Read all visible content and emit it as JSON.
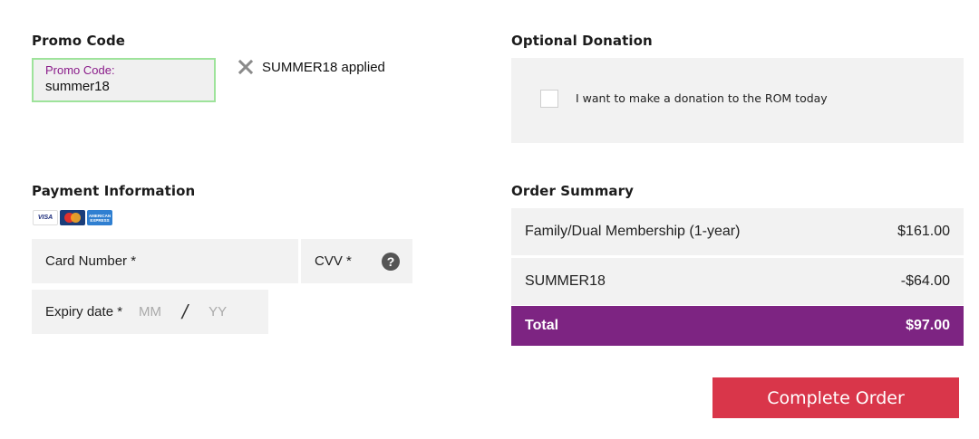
{
  "promo": {
    "title": "Promo Code",
    "field_label": "Promo Code:",
    "field_value": "summer18",
    "applied_text": "SUMMER18 applied"
  },
  "donation": {
    "title": "Optional Donation",
    "checkbox_label": "I want to make a donation to the ROM today",
    "checked": false
  },
  "payment": {
    "title": "Payment Information",
    "card_logos": [
      "VISA",
      "MasterCard",
      "AMERICAN EXPRESS"
    ],
    "card_number_label": "Card Number *",
    "cvv_label": "CVV *",
    "help_glyph": "?",
    "expiry_label": "Expiry date *",
    "expiry_month_placeholder": "MM",
    "expiry_separator": "/",
    "expiry_year_placeholder": "YY"
  },
  "summary": {
    "title": "Order Summary",
    "items": [
      {
        "label": "Family/Dual Membership (1-year)",
        "amount": "$161.00"
      },
      {
        "label": "SUMMER18",
        "amount": "-$64.00"
      }
    ],
    "total_label": "Total",
    "total_amount": "$97.00"
  },
  "actions": {
    "complete_label": "Complete Order"
  },
  "colors": {
    "accent_purple": "#7d2482",
    "button_red": "#d9364a",
    "promo_border_green": "#9ee39b"
  }
}
